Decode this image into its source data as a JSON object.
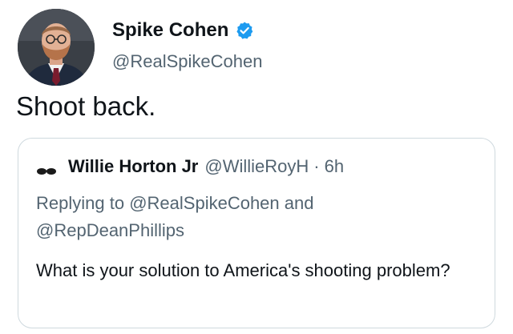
{
  "tweet": {
    "author_name": "Spike Cohen",
    "author_handle": "@RealSpikeCohen",
    "verified_icon": "verified-badge-icon",
    "text": "Shoot back."
  },
  "quoted": {
    "author_name": "Willie Horton Jr",
    "author_handle": "@WillieRoyH",
    "separator": "·",
    "time": "6h",
    "reply_prefix": "Replying to",
    "reply_user1": "@RealSpikeCohen",
    "reply_and": "and",
    "reply_user2": "@RepDeanPhillips",
    "text": "What is your solution to America's shooting problem?"
  },
  "colors": {
    "verified": "#1d9bf0",
    "secondary_text": "#536471",
    "border": "#cfd9de"
  }
}
